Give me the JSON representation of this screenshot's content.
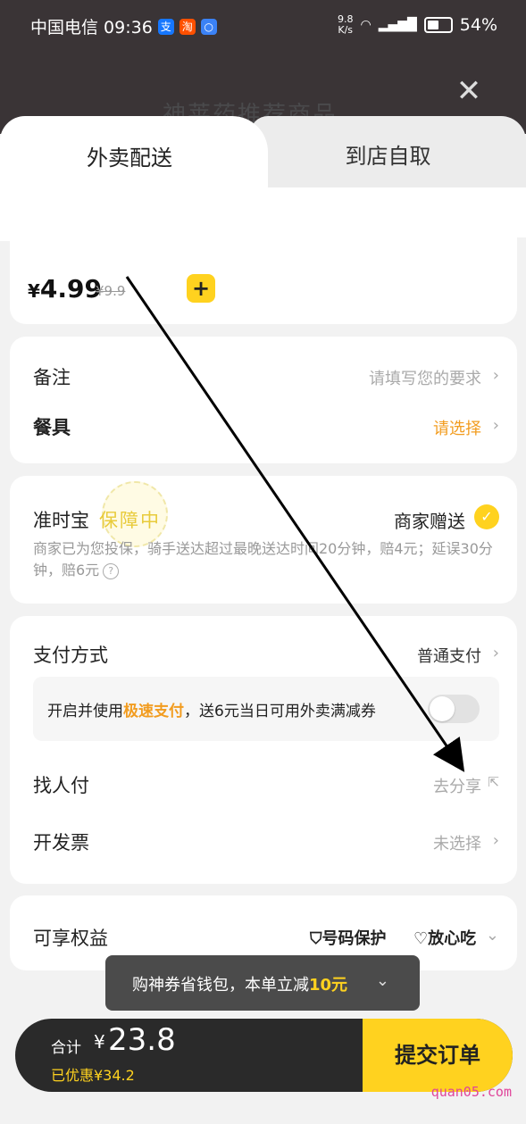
{
  "status_bar": {
    "carrier_time": "中国电信 09:36",
    "app_icons": [
      "支",
      "淘",
      "○"
    ],
    "net_speed_top": "9.8",
    "net_speed_bottom": "K/s",
    "battery": "54%"
  },
  "header": {
    "ghost_title": "神莱药推荐商品"
  },
  "tabs": [
    {
      "label": "外卖配送",
      "active": true
    },
    {
      "label": "到店自取",
      "active": false
    }
  ],
  "item": {
    "price_symbol": "¥",
    "price": "4.99",
    "original_price": "¥9.9",
    "add_label": "+"
  },
  "notes": {
    "remark_label": "备注",
    "remark_placeholder": "请填写您的要求",
    "cutlery_label": "餐具",
    "cutlery_value": "请选择"
  },
  "ontime": {
    "label": "准时宝",
    "seal_text": "保障中",
    "gift_label": "商家赠送",
    "description": "商家已为您投保，骑手送达超过最晚送达时间20分钟，赔4元；延误30分钟，赔6元"
  },
  "payment": {
    "method_label": "支付方式",
    "method_value": "普通支付",
    "fast_pay_prefix": "开启并使用",
    "fast_pay_highlight": "极速支付",
    "fast_pay_suffix": "，送6元当日可用外卖满减券",
    "fast_pay_enabled": false,
    "find_pay_label": "找人付",
    "find_pay_value": "去分享",
    "invoice_label": "开发票",
    "invoice_value": "未选择"
  },
  "benefits": {
    "label": "可享权益",
    "items": [
      "号码保护",
      "放心吃"
    ]
  },
  "toast": {
    "prefix": "购神券省钱包，本单立减",
    "highlight": "10元"
  },
  "checkout": {
    "total_label": "合计",
    "currency": "¥",
    "total": "23.8",
    "saved": "已优惠¥34.2",
    "submit_label": "提交订单"
  },
  "watermark": "quan05.com",
  "colors": {
    "accent_yellow": "#ffd21f",
    "orange": "#f29c1f",
    "header_dark": "#3a3436",
    "bottom_dark": "#2a2a2a"
  }
}
